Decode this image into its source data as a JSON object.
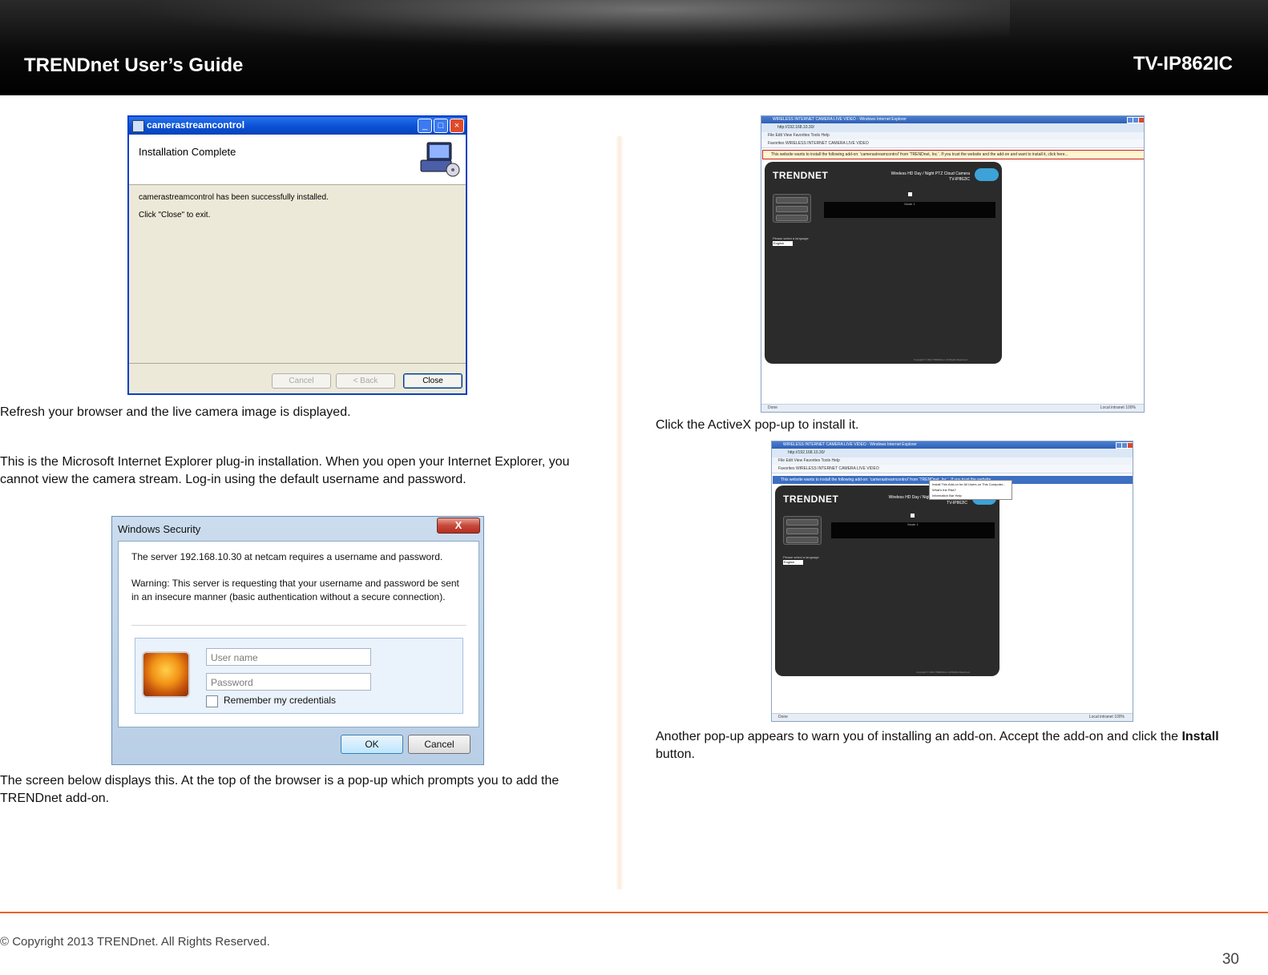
{
  "header": {
    "title": "TRENDnet User’s Guide",
    "model": "TV-IP862IC"
  },
  "install_dialog": {
    "title": "camerastreamcontrol",
    "heading": "Installation Complete",
    "message": "camerastreamcontrol has been successfully installed.",
    "instruction": "Click \"Close\" to exit.",
    "buttons": {
      "cancel": "Cancel",
      "back": "< Back",
      "close": "Close"
    }
  },
  "left_text": {
    "p1": "Refresh your browser and the live camera image is displayed.",
    "p2": "This is the Microsoft Internet Explorer plug-in installation. When you open your Internet Explorer, you cannot view the camera stream. Log-in using the default username and password.",
    "p3": "The screen below displays this. At the top of the browser is a pop-up which prompts you to add the TRENDnet add-on."
  },
  "security_dialog": {
    "title": "Windows Security",
    "close_label": "X",
    "line1": "The server 192.168.10.30 at netcam requires a username and password.",
    "line2": "Warning: This server is requesting that your username and password be sent in an insecure manner (basic authentication without a secure connection).",
    "username_placeholder": "User name",
    "password_placeholder": "Password",
    "remember_label": "Remember my credentials",
    "ok_label": "OK",
    "cancel_label": "Cancel"
  },
  "browser_1": {
    "window_title": "WIRELESS INTERNET CAMERA LIVE VIDEO - Windows Internet Explorer",
    "address": "http://192.168.10.30/",
    "menu": "File   Edit   View   Favorites   Tools   Help",
    "favorites": "Favorites     WIRELESS INTERNET CAMERA LIVE VIDEO",
    "infobar": "This website wants to install the following add-on: 'camerastreamcontrol' from 'TRENDnet, Inc.'. If you trust the website and the add-on and want to install it, click here...",
    "logo": "TRENDNET",
    "product_line1": "Wireless HD Day / Night PTZ Cloud Camera",
    "product_line2": "TV-IP862IC",
    "video_label": "Mode 1",
    "side_buttons": [
      "Live View",
      "Playback",
      "Registration"
    ],
    "language_prompt": "Please select a language",
    "language_value": "English",
    "copyright": "Copyright © 2013 TRENDnet. All Rights Reserved.",
    "status_left": "Done",
    "status_right": "Local intranet   100%"
  },
  "right_text": {
    "p1": "Click the ActiveX pop-up to install it.",
    "p2_prefix": "Another pop-up appears to warn you of installing an add-on. Accept the add-on and click the ",
    "p2_bold": "Install",
    "p2_suffix": " button."
  },
  "browser_2": {
    "window_title": "WIRELESS INTERNET CAMERA LIVE VIDEO - Windows Internet Explorer",
    "address": "http://192.168.10.30/",
    "menu": "File   Edit   View   Favorites   Tools   Help",
    "favorites": "Favorites     WIRELESS INTERNET CAMERA LIVE VIDEO",
    "infobar": "This website wants to install the following add-on: 'camerastreamcontrol' from 'TRENDnet, Inc.'. If you trust the website...",
    "context_menu": [
      "Install This Add-on for All Users on This Computer...",
      "What's the Risk?",
      "Information Bar Help"
    ],
    "logo": "TRENDNET",
    "product_line1": "Wireless HD Day / Night PTZ Cloud Camera",
    "product_line2": "TV-IP862IC",
    "video_label": "Mode 1",
    "side_buttons": [
      "Live View",
      "Playback",
      "Registration"
    ],
    "language_prompt": "Please select a language",
    "language_value": "English",
    "copyright": "Copyright © 2013 TRENDnet. All Rights Reserved.",
    "status_left": "Done",
    "status_right": "Local intranet   100%"
  },
  "footer": {
    "copyright": "© Copyright 2013 TRENDnet. All Rights Reserved.",
    "page": "30"
  }
}
